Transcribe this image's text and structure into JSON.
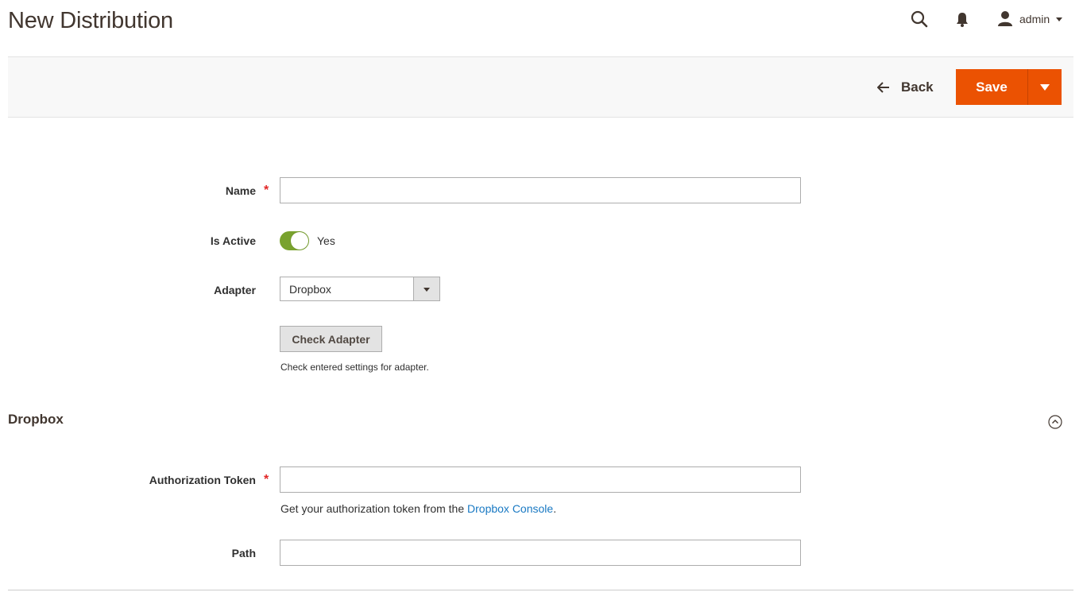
{
  "header": {
    "title": "New Distribution",
    "user_name": "admin"
  },
  "toolbar": {
    "back_label": "Back",
    "save_label": "Save"
  },
  "form": {
    "name_label": "Name",
    "name_value": "",
    "is_active_label": "Is Active",
    "is_active_value": "Yes",
    "adapter_label": "Adapter",
    "adapter_value": "Dropbox",
    "check_adapter_label": "Check Adapter",
    "check_adapter_note": "Check entered settings for adapter."
  },
  "dropbox_section": {
    "title": "Dropbox",
    "token_label": "Authorization Token",
    "token_value": "",
    "token_hint_prefix": "Get your authorization token from the ",
    "token_hint_link": "Dropbox Console",
    "token_hint_suffix": ".",
    "path_label": "Path",
    "path_value": ""
  },
  "colors": {
    "primary": "#eb5202",
    "toggle_on": "#79a22e",
    "link": "#1979c3",
    "required": "#e22626"
  },
  "icons": {
    "search": "search-icon",
    "notifications": "bell-icon",
    "user": "user-icon",
    "back": "arrow-left-icon",
    "collapse": "chevron-up-circle-icon"
  }
}
